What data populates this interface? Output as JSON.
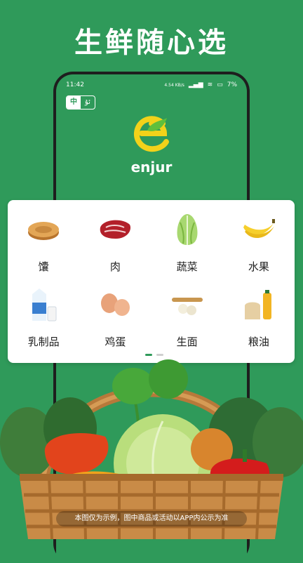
{
  "headline": "生鲜随心选",
  "status_bar": {
    "time": "11:42",
    "speed": "4.54 KB/s",
    "battery": "7%"
  },
  "lang_toggle": {
    "active": "中",
    "inactive": "ئۇ"
  },
  "brand": {
    "name": "enjur"
  },
  "categories": [
    {
      "label": "馕",
      "icon": "naan-bread-icon"
    },
    {
      "label": "肉",
      "icon": "steak-icon"
    },
    {
      "label": "蔬菜",
      "icon": "cabbage-icon"
    },
    {
      "label": "水果",
      "icon": "banana-icon"
    },
    {
      "label": "乳制品",
      "icon": "milk-icon"
    },
    {
      "label": "鸡蛋",
      "icon": "egg-icon"
    },
    {
      "label": "生面",
      "icon": "dough-icon"
    },
    {
      "label": "粮油",
      "icon": "grain-oil-icon"
    }
  ],
  "pager": {
    "count": 2,
    "active": 0
  },
  "disclaimer": "本图仅为示例，图中商品或活动以APP内公示为准",
  "colors": {
    "brand_green": "#2f9a5a",
    "logo_yellow": "#f2d21a",
    "logo_green": "#5fbf3c"
  }
}
